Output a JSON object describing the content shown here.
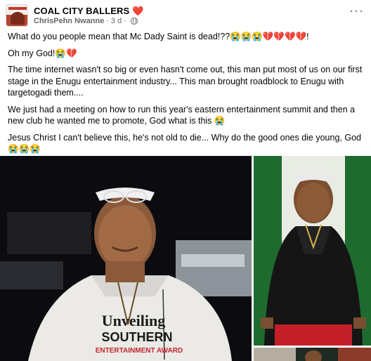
{
  "post": {
    "group_name": "COAL CITY BALLERS",
    "group_emoji": "❤️",
    "author": "ChrisPehn Nwanne",
    "time": "3 d",
    "more_label": "···"
  },
  "body": {
    "p1": "What do you people mean that Mc Dady Saint is dead!??😭😭😭💔💔💔💔!",
    "p2": "Oh my God!😭💔",
    "p3": "The time internet wasn't so big or even hasn't come out, this man put most of us on our first stage in the Enugu entertainment industry... This man brought roadblock to Enugu with targetogadi them....",
    "p4": "We just had a meeting on how to run this year's eastern entertainment summit and then a new club he wanted me to promote, God what is this 😭",
    "p5": "Jesus Christ I can't believe this, he's not old to die... Why do the good ones die young, God 😭😭😭"
  },
  "photos": {
    "shirt_line1": "Unveiling",
    "shirt_line2": "SOUTHERN",
    "shirt_line3": "ENTERTAINMENT AWARD"
  },
  "colors": {
    "accent_heart": "#e41e3f",
    "meta_text": "#65676b"
  }
}
